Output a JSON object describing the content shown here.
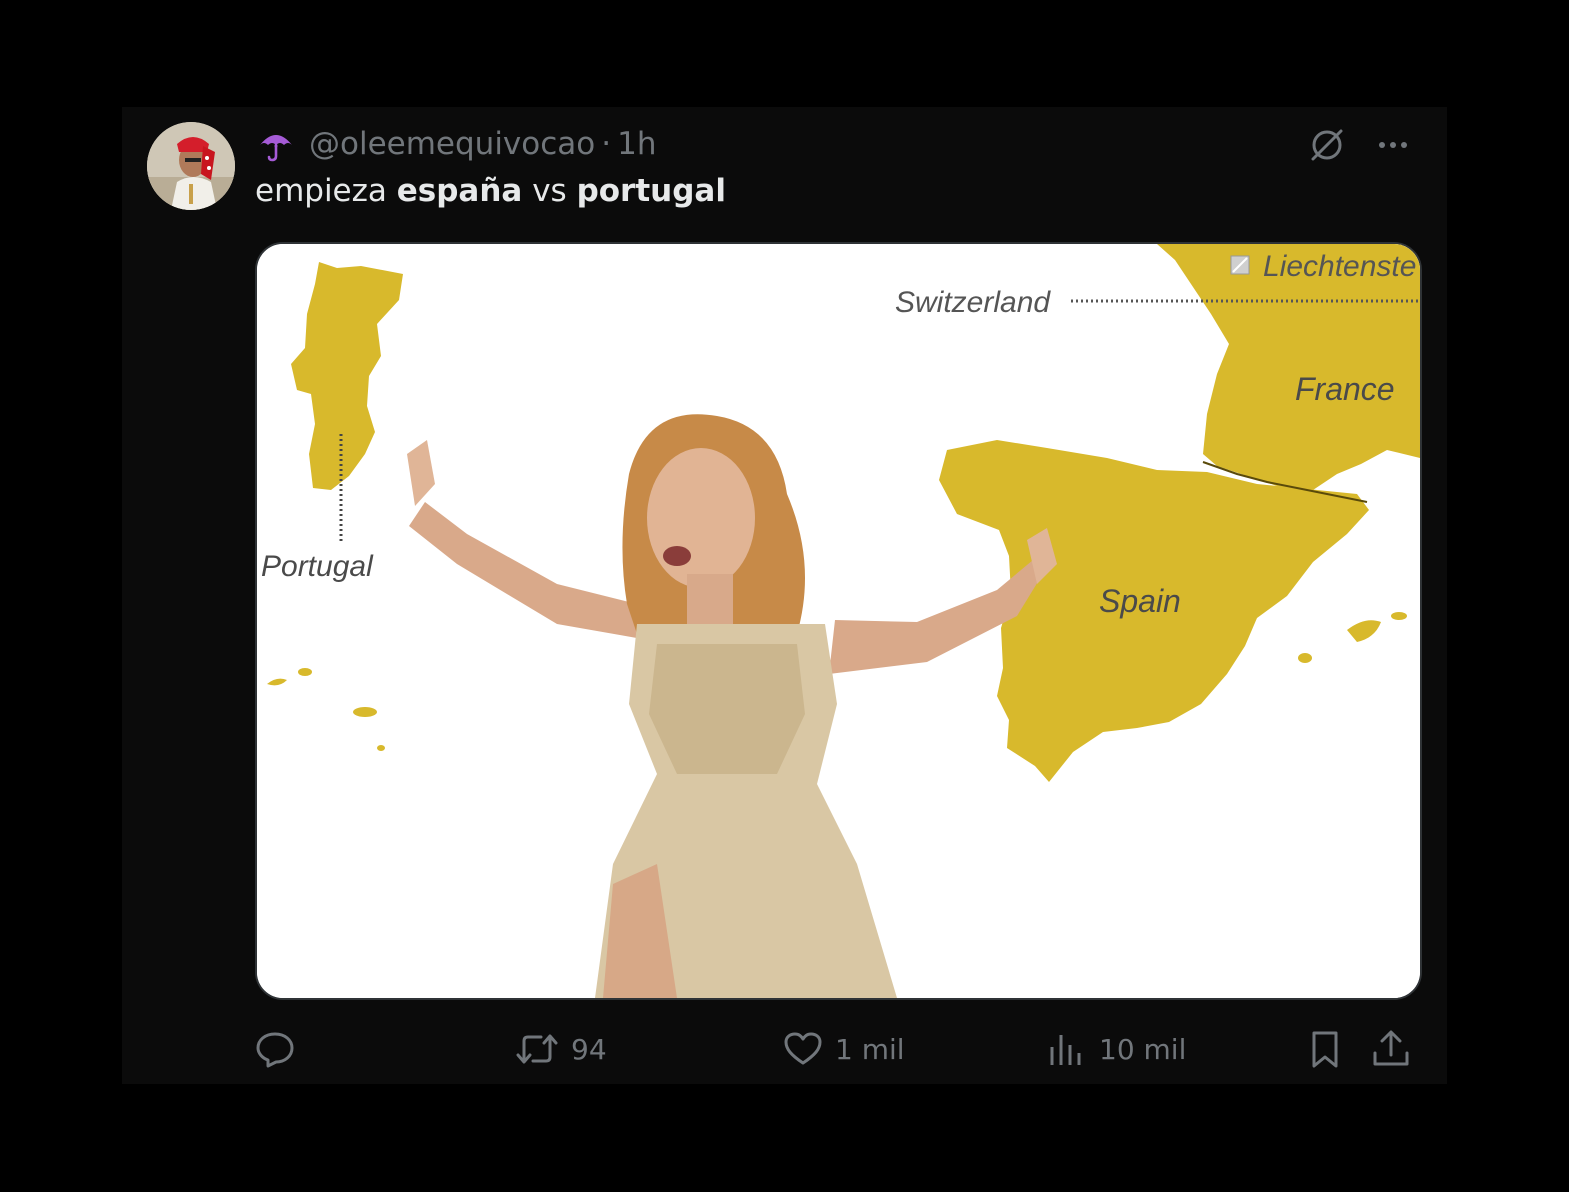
{
  "post": {
    "handle": "@oleemequivocao",
    "separator": "·",
    "time": "1h",
    "text": {
      "part1": "empieza ",
      "bold1": "españa",
      "part2": " vs ",
      "bold2": "portugal"
    },
    "emoji_icon": "umbrella-icon",
    "image": {
      "labels": {
        "portugal": "Portugal",
        "spain": "Spain",
        "france": "France",
        "switzerland": "Switzerland",
        "liechtenstein": "Liechtenste"
      },
      "colors": {
        "land": "#d8b92c",
        "background": "#ffffff"
      }
    }
  },
  "actions": {
    "reply_count": "",
    "retweet_count": "94",
    "like_count": "1 mil",
    "views_count": "10 mil"
  },
  "icons": {
    "grok": "slash-circle-icon",
    "more": "more-icon",
    "reply": "reply-icon",
    "retweet": "retweet-icon",
    "like": "heart-icon",
    "views": "views-icon",
    "bookmark": "bookmark-icon",
    "share": "share-icon"
  }
}
